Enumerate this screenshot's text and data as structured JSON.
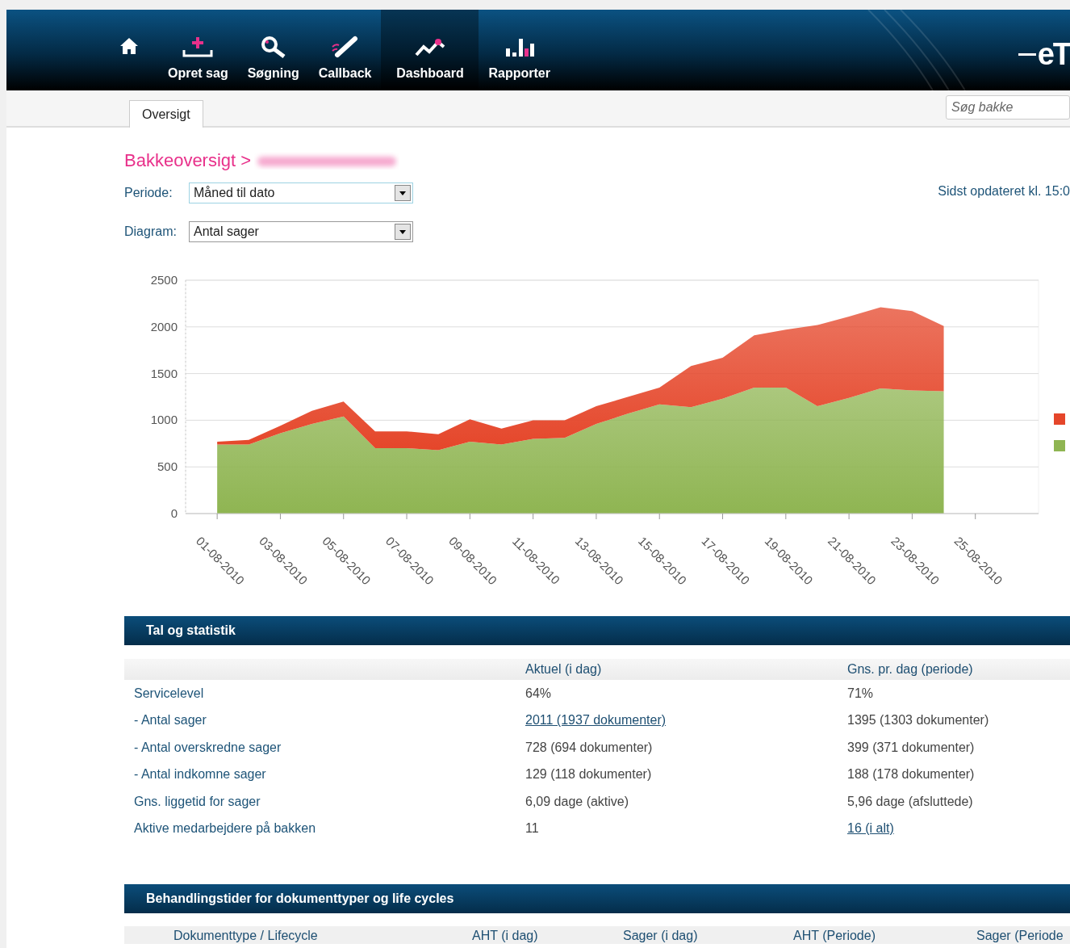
{
  "nav": {
    "items": [
      {
        "label": "Opret sag",
        "selected": false
      },
      {
        "label": "Søgning",
        "selected": false
      },
      {
        "label": "Callback",
        "selected": false
      },
      {
        "label": "Dashboard",
        "selected": true
      },
      {
        "label": "Rapporter",
        "selected": false
      }
    ],
    "logo": "eT"
  },
  "tabs": [
    {
      "label": "Oversigt",
      "selected": true
    }
  ],
  "search": {
    "placeholder": "Søg bakke"
  },
  "breadcrumb": "Bakkeoversigt >",
  "filters": [
    {
      "label": "Periode:",
      "value": "Måned til dato"
    },
    {
      "label": "Diagram:",
      "value": "Antal sager"
    }
  ],
  "last_updated": "Sidst opdateret kl. 15:0",
  "chart": {
    "chart_data": {
      "type": "area",
      "stacked": true,
      "grid": true,
      "ylim": [
        0,
        2500
      ],
      "yticks": [
        0,
        500,
        1000,
        1500,
        2000,
        2500
      ],
      "categories": [
        "01-08-2010",
        null,
        "03-08-2010",
        null,
        "05-08-2010",
        null,
        "07-08-2010",
        null,
        "09-08-2010",
        null,
        "11-08-2010",
        null,
        "13-08-2010",
        null,
        "15-08-2010",
        null,
        "17-08-2010",
        null,
        "19-08-2010",
        null,
        "21-08-2010",
        null,
        "23-08-2010",
        null,
        "25-08-2010"
      ],
      "series": [
        {
          "color": "#8fb552",
          "values": [
            740,
            740,
            860,
            960,
            1040,
            700,
            700,
            680,
            770,
            740,
            800,
            810,
            960,
            1070,
            1170,
            1140,
            1230,
            1350,
            1350,
            1150,
            1240,
            1340,
            1320,
            1310,
            null
          ]
        },
        {
          "color": "#e5462a",
          "values": [
            30,
            50,
            80,
            140,
            160,
            180,
            180,
            170,
            240,
            170,
            200,
            190,
            190,
            180,
            180,
            440,
            440,
            560,
            620,
            870,
            870,
            870,
            850,
            700,
            null
          ]
        }
      ]
    }
  },
  "stats": {
    "title": "Tal og statistik",
    "header_1": "Aktuel (i dag)",
    "header_2": "Gns. pr. dag (periode)",
    "rows": [
      {
        "label": "Servicelevel",
        "today": {
          "text": "64%",
          "kind": "text"
        },
        "period": {
          "text": "71%",
          "kind": "text"
        }
      },
      {
        "label": "- Antal sager",
        "today": {
          "text": "2011 (1937 dokumenter)",
          "kind": "link"
        },
        "period": {
          "text": "1395 (1303 dokumenter)",
          "kind": "text"
        }
      },
      {
        "label": "- Antal overskredne sager",
        "today": {
          "text": "728 (694 dokumenter)",
          "kind": "text"
        },
        "period": {
          "text": "399 (371 dokumenter)",
          "kind": "text"
        }
      },
      {
        "label": "- Antal indkomne sager",
        "today": {
          "text": "129 (118 dokumenter)",
          "kind": "text"
        },
        "period": {
          "text": "188 (178 dokumenter)",
          "kind": "text"
        }
      },
      {
        "label": "Gns. liggetid for sager",
        "today": {
          "text": "6,09 dage (aktive)",
          "kind": "text"
        },
        "period": {
          "text": "5,96 dage (afsluttede)",
          "kind": "text"
        }
      },
      {
        "label": "Aktive medarbejdere på bakken",
        "today": {
          "text": "11",
          "kind": "text"
        },
        "period": {
          "text": "16 (i alt)",
          "kind": "link"
        }
      }
    ]
  },
  "times": {
    "title": "Behandlingstider for dokumenttyper og life cycles",
    "columns": [
      "Dokumenttype / Lifecycle",
      "AHT (i dag)",
      "Sager (i dag)",
      "AHT (Periode)",
      "Sager (Periode"
    ]
  }
}
